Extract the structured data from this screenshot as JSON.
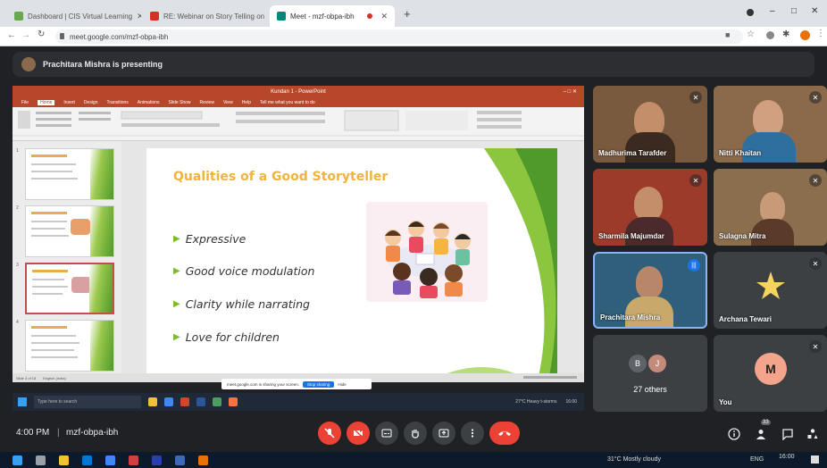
{
  "browser": {
    "tabs": [
      {
        "label": "Dashboard | CIS Virtual Learning",
        "color": "#6aa84f"
      },
      {
        "label": "RE: Webinar on Story Telling on",
        "color": "#d93025"
      },
      {
        "label": "Meet - mzf-obpa-ibh",
        "color": "#00897b"
      }
    ],
    "new_tab": "+",
    "url": "meet.google.com/mzf-obpa-ibh",
    "window_controls": [
      "–",
      "□",
      "✕"
    ]
  },
  "meet": {
    "presenter_banner": "Prachitara Mishra is presenting",
    "participants": [
      {
        "name": "Madhurima Tarafder",
        "bg": "#7a5a3e"
      },
      {
        "name": "Nitti Khaitan",
        "bg": "#8a6a4a"
      },
      {
        "name": "Sharmila Majumdar",
        "bg": "#9c3b2a"
      },
      {
        "name": "Sulagna Mitra",
        "bg": "#8b6e4e"
      },
      {
        "name": "Prachitara Mishra",
        "bg": "#2f5f7a"
      },
      {
        "name": "Archana Tewari",
        "bg": "#3c4043"
      }
    ],
    "others": {
      "avatar_b": "B",
      "avatar_j": "J",
      "label": "27 others"
    },
    "you_label": "You",
    "time": "4:00 PM",
    "meeting_code": "mzf-obpa-ibh",
    "people_count": "33"
  },
  "powerpoint": {
    "title": "Kundan 1 - PowerPoint",
    "menu": [
      "File",
      "Home",
      "Insert",
      "Design",
      "Transitions",
      "Animations",
      "Slide Show",
      "Review",
      "View",
      "Help",
      "Tell me what you want to do"
    ],
    "slide_title": "Qualities of a Good Storyteller",
    "bullets": [
      "Expressive",
      "Good voice modulation",
      "Clarity while narrating",
      "Love for children"
    ],
    "status_left": "Slide 3 of 18",
    "status_mid": "English (India)",
    "thumb_numbers": [
      "1",
      "2",
      "3",
      "4"
    ]
  },
  "share_notice": {
    "text": "meet.google.com is sharing your screen.",
    "stop": "Stop sharing",
    "hide": "Hide"
  },
  "inner_taskbar": {
    "search": "Type here to search",
    "weather": "27°C Heavy t-storms",
    "clock": "16:00"
  },
  "host_taskbar": {
    "weather": "31°C Mostly cloudy",
    "lang": "ENG",
    "clock": "16:00"
  },
  "colors": {
    "meet_bg": "#202124",
    "end_call": "#ea4335",
    "ppt_accent": "#b7472a",
    "slide_title": "#f0b43c",
    "bullet_arrow": "#7dbb2e"
  }
}
